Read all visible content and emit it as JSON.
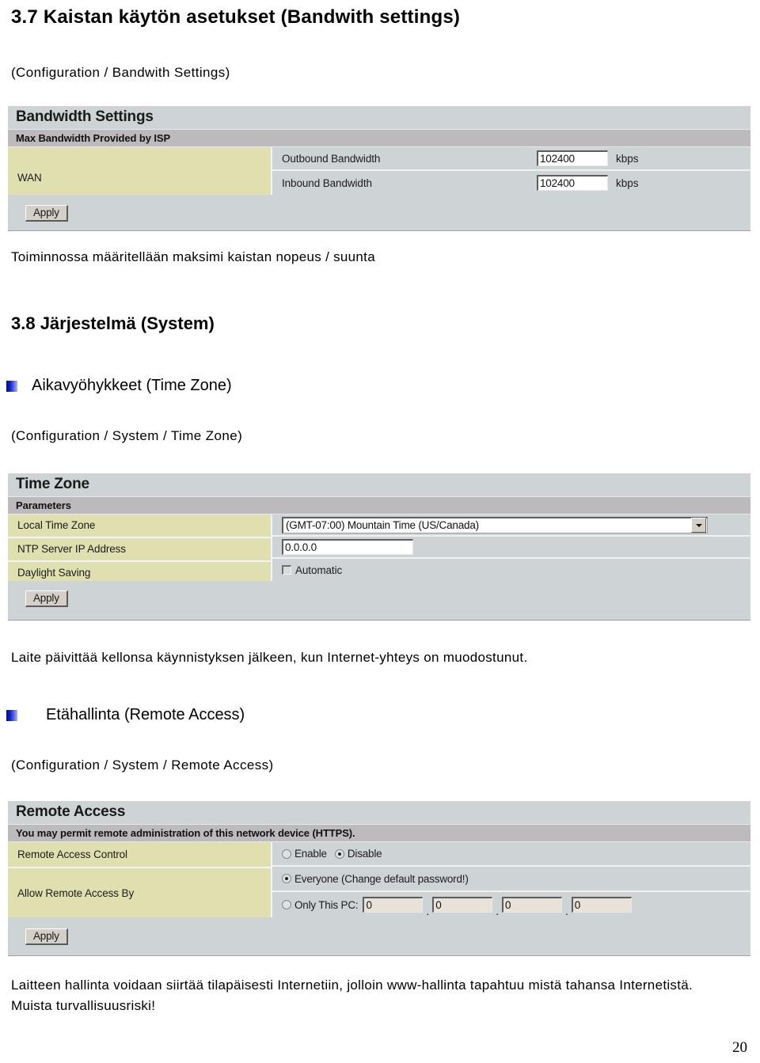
{
  "doc": {
    "heading_37": "3.7 Kaistan käytön asetukset (Bandwith settings)",
    "path_bandwidth": "(Configuration / Bandwith Settings)",
    "note_bandwidth": "Toiminnossa määritellään maksimi kaistan nopeus / suunta",
    "heading_38": "3.8 Järjestelmä (System)",
    "bullet_timezone": "Aikavyöhykkeet (Time Zone)",
    "path_timezone": "(Configuration / System / Time Zone)",
    "note_timezone": "Laite päivittää kellonsa käynnistyksen jälkeen, kun Internet-yhteys on muodostunut.",
    "bullet_remote": "Etähallinta (Remote Access)",
    "path_remote": "(Configuration / System / Remote Access)",
    "note_remote": "Laitteen hallinta voidaan siirtää tilapäisesti Internetiin, jolloin www-hallinta tapahtuu mistä tahansa Internetistä. Muista turvallisuusriski!",
    "page_number": "20"
  },
  "bandwidth_panel": {
    "title": "Bandwidth Settings",
    "subhead": "Max Bandwidth Provided by ISP",
    "wan_label": "WAN",
    "rows": [
      {
        "label": "Outbound Bandwidth",
        "value": "102400",
        "unit": "kbps"
      },
      {
        "label": "Inbound Bandwidth",
        "value": "102400",
        "unit": "kbps"
      }
    ],
    "apply_label": "Apply"
  },
  "timezone_panel": {
    "title": "Time Zone",
    "subhead": "Parameters",
    "labels": {
      "local_time_zone": "Local Time Zone",
      "ntp_server": "NTP Server IP Address",
      "daylight_saving": "Daylight Saving"
    },
    "local_time_zone_value": "(GMT-07:00) Mountain Time (US/Canada)",
    "ntp_server_value": "0.0.0.0",
    "daylight_saving_label": "Automatic",
    "daylight_saving_checked": false,
    "apply_label": "Apply"
  },
  "remote_panel": {
    "title": "Remote Access",
    "subhead": "You may permit remote administration of this network device (HTTPS).",
    "labels": {
      "control": "Remote Access Control",
      "allow_by": "Allow Remote Access By"
    },
    "control_options": [
      {
        "label": "Enable",
        "selected": false
      },
      {
        "label": "Disable",
        "selected": true
      }
    ],
    "allow_everyone": {
      "label": "Everyone (Change default password!)",
      "selected": true
    },
    "allow_only_pc": {
      "label": "Only This PC:",
      "selected": false
    },
    "only_pc_octets": [
      "0",
      "0",
      "0",
      "0"
    ],
    "separator": ".",
    "apply_label": "Apply"
  },
  "colors": {
    "panel_bg": "#ced3d6",
    "subhead_bg": "#bdbabe",
    "label_col_bg": "#e0dfaf",
    "bullet_blue": "#1621c8"
  }
}
